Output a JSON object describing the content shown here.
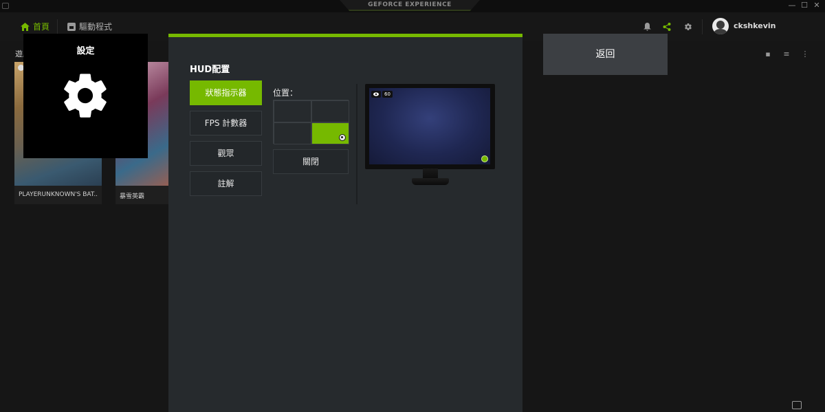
{
  "window": {
    "app_title": "GEFORCE EXPERIENCE",
    "controls": [
      "—",
      "☐",
      "✕"
    ]
  },
  "nav": {
    "home_label": "首頁",
    "driver_label": "驅動程式",
    "username": "ckshkevin",
    "icons": [
      "bell-icon",
      "share-icon",
      "gear-icon"
    ]
  },
  "background": {
    "section_label": "遊戲",
    "games": [
      {
        "caption": "PLAYERUNKNOWN'S BAT..."
      },
      {
        "caption": "暴雪英霸"
      }
    ]
  },
  "settings_tile": {
    "title": "設定",
    "icon": "gear-icon"
  },
  "panel": {
    "title": "HUD配置",
    "side_buttons": [
      "狀態指示器",
      "FPS 計數器",
      "觀眾",
      "註解"
    ],
    "active_index": 0,
    "position_label": "位置：",
    "selected_position": "bottom-right",
    "close_label": "關閉",
    "preview": {
      "fps": "60",
      "eye_icon": "eye-icon"
    }
  },
  "back_button": {
    "label": "返回"
  },
  "colors": {
    "accent": "#76b900",
    "panel": "#262a2d",
    "background": "#141414"
  }
}
